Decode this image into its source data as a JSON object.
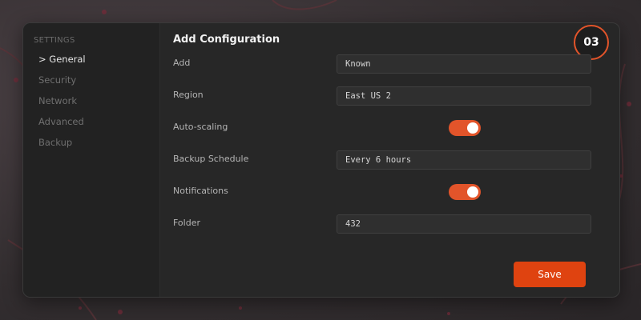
{
  "sidebar": {
    "heading": "SETTINGS",
    "items": [
      {
        "label": "> General",
        "active": true
      },
      {
        "label": "Security",
        "active": false
      },
      {
        "label": "Network",
        "active": false
      },
      {
        "label": "Advanced",
        "active": false
      },
      {
        "label": "Backup",
        "active": false
      }
    ]
  },
  "main": {
    "title": "Add Configuration",
    "step_badge": "03",
    "fields": [
      {
        "label": "Add",
        "type": "text",
        "value": "Known"
      },
      {
        "label": "Region",
        "type": "text",
        "value": "East US 2"
      },
      {
        "label": "Auto-scaling",
        "type": "toggle",
        "on": true
      },
      {
        "label": "Backup Schedule",
        "type": "text",
        "value": "Every 6 hours"
      },
      {
        "label": "Notifications",
        "type": "toggle",
        "on": true
      },
      {
        "label": "Folder",
        "type": "text",
        "value": "432"
      }
    ],
    "save_label": "Save"
  },
  "colors": {
    "accent": "#e2542a",
    "save_button": "#df4310",
    "panel": "#272727",
    "sidebar": "#222222"
  }
}
